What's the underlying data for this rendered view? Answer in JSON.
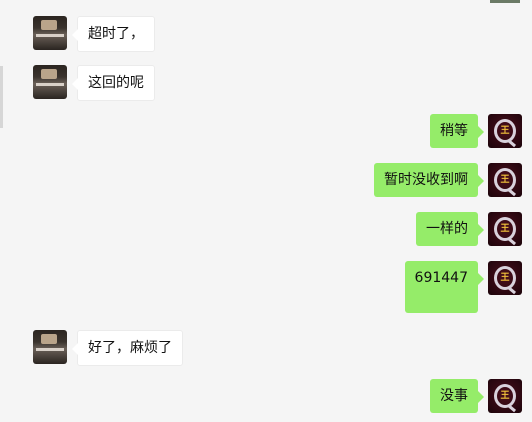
{
  "chat": {
    "messages": [
      {
        "side": "left",
        "text": "超时了，"
      },
      {
        "side": "left",
        "text": "这回的呢"
      },
      {
        "side": "right",
        "text": "稍等"
      },
      {
        "side": "right",
        "text": "暂时没收到啊"
      },
      {
        "side": "right",
        "text": "一样的"
      },
      {
        "side": "right",
        "text": "691447"
      },
      {
        "side": "left",
        "text": "好了，麻烦了"
      },
      {
        "side": "right",
        "text": "没事"
      }
    ]
  },
  "avatars": {
    "self_glyph": "王",
    "other_icon": "photo-avatar-icon",
    "self_icon": "q-logo-avatar-icon"
  },
  "colors": {
    "background": "#f5f5f5",
    "self_bubble": "#95ec69",
    "other_bubble": "#ffffff"
  }
}
